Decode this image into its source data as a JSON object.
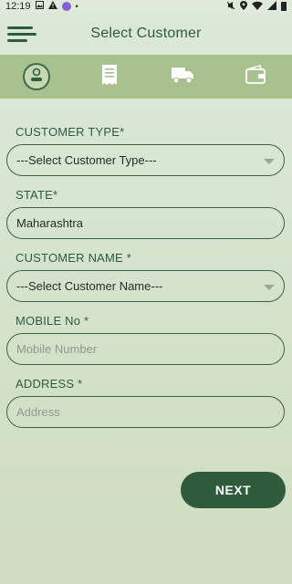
{
  "status_bar": {
    "time": "12:19",
    "left_icons": [
      "image-icon",
      "warning-icon",
      "app-badge-icon",
      "dot-icon"
    ],
    "right_icons": [
      "mute-icon",
      "location-icon",
      "wifi-icon",
      "signal-icon",
      "battery-icon"
    ]
  },
  "header": {
    "title": "Select Customer"
  },
  "tabs": [
    {
      "icon": "person-icon",
      "active": true
    },
    {
      "icon": "receipt-icon",
      "active": false
    },
    {
      "icon": "delivery-truck-icon",
      "active": false
    },
    {
      "icon": "wallet-icon",
      "active": false
    }
  ],
  "form": {
    "customer_type": {
      "label": "CUSTOMER TYPE*",
      "value": "---Select Customer Type---"
    },
    "state": {
      "label": "STATE*",
      "value": "Maharashtra"
    },
    "customer_name": {
      "label": "CUSTOMER NAME *",
      "value": "---Select Customer Name---"
    },
    "mobile": {
      "label": "MOBILE No *",
      "placeholder": "Mobile Number"
    },
    "address": {
      "label": "ADDRESS *",
      "placeholder": "Address"
    }
  },
  "next_button": {
    "label": "NEXT"
  },
  "colors": {
    "primary": "#2f5b3d",
    "tab_bar": "#a9c08f",
    "background": "#d6e4cf"
  }
}
